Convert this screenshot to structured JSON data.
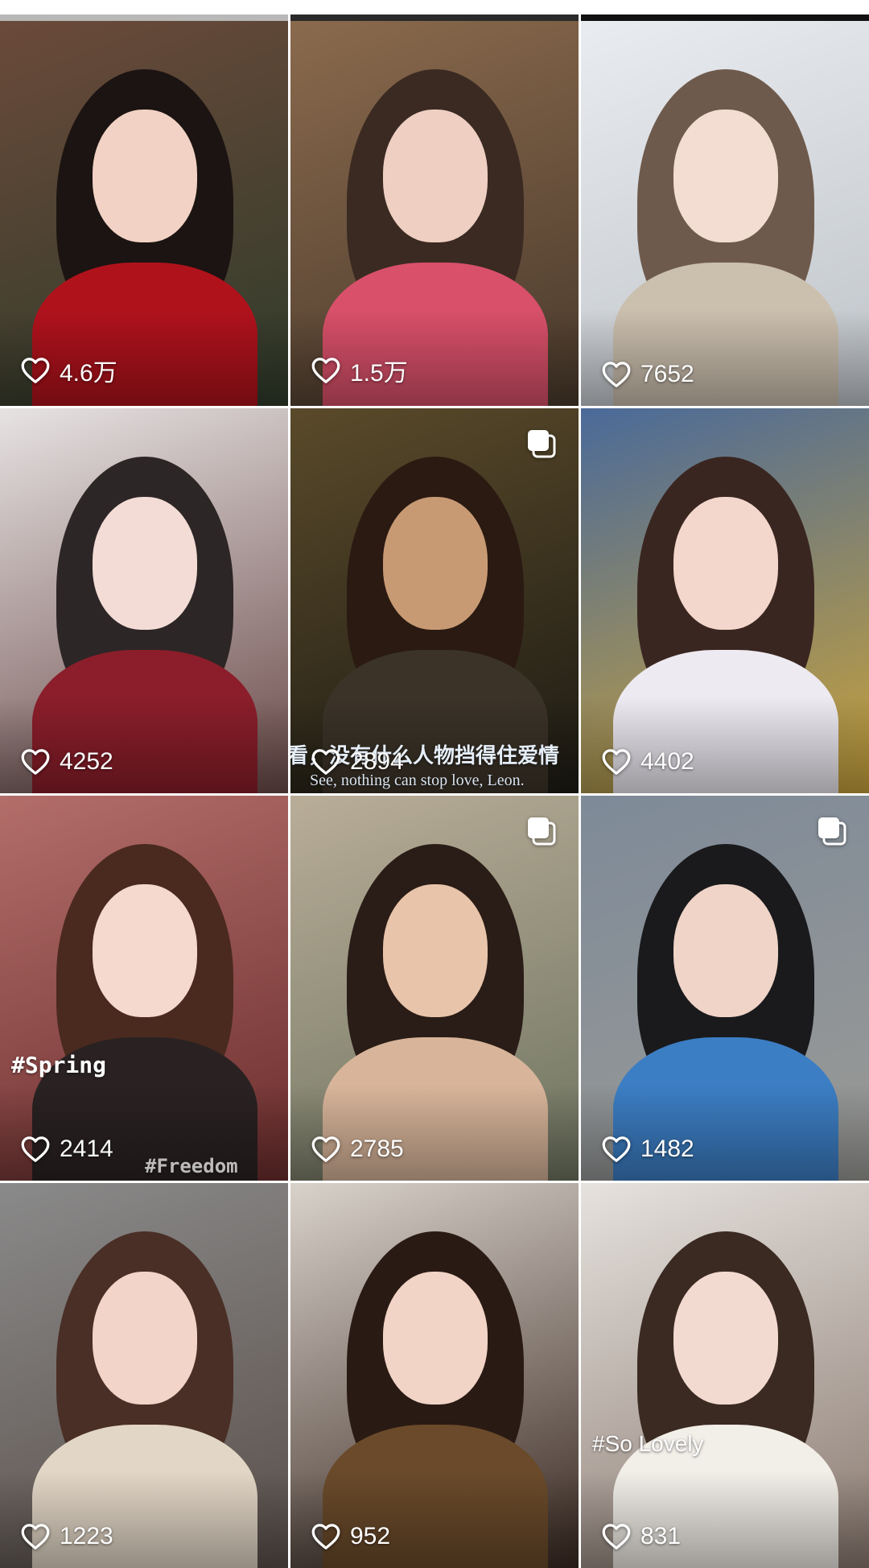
{
  "feed": {
    "tiles": [
      {
        "likes": "4.6万",
        "multi": false,
        "overlay": null,
        "bg": [
          "#6b4a3a",
          "#2f3b2a"
        ],
        "hair": "#1b1412",
        "face": "#f1d2c4",
        "body": "#b0121c"
      },
      {
        "likes": "1.5万",
        "multi": false,
        "overlay": null,
        "bg": [
          "#8a6a4d",
          "#4a3a2c"
        ],
        "hair": "#3a2a22",
        "face": "#efcfc2",
        "body": "#d9506a"
      },
      {
        "likes": "7652",
        "multi": false,
        "overlay": null,
        "bg": [
          "#e9ecf0",
          "#bfc4c9"
        ],
        "hair": "#6e5a4c",
        "face": "#f3dcd2",
        "body": "#cbbfae"
      },
      {
        "likes": "4252",
        "multi": false,
        "overlay": null,
        "bg": [
          "#e7e3e3",
          "#6a4a48"
        ],
        "hair": "#2d2626",
        "face": "#f4dcd6",
        "body": "#8b1e2a"
      },
      {
        "likes": "2894",
        "multi": true,
        "overlay": {
          "lines": [
            "看，没有什么人物挡得住爱情",
            "See, nothing can stop love, Leon."
          ]
        },
        "bg": [
          "#5a4a2a",
          "#1d1b14"
        ],
        "hair": "#2a1a12",
        "face": "#c89a74",
        "body": "#3b3328"
      },
      {
        "likes": "4402",
        "multi": false,
        "overlay": null,
        "bg": [
          "#4a6a9a",
          "#c9a23a"
        ],
        "hair": "#3a2620",
        "face": "#f3d6cc",
        "body": "#eeeaf2"
      },
      {
        "likes": "2414",
        "multi": false,
        "overlay": {
          "lines": [
            "#Spring",
            "#Freedom"
          ]
        },
        "bg": [
          "#b36e6a",
          "#6b2d2d"
        ],
        "hair": "#4a2a1e",
        "face": "#f5d8ce",
        "body": "#2a2222"
      },
      {
        "likes": "2785",
        "multi": true,
        "overlay": null,
        "bg": [
          "#b9ad98",
          "#6e7460"
        ],
        "hair": "#2a1c16",
        "face": "#e8c4aa",
        "body": "#d8b59a"
      },
      {
        "likes": "1482",
        "multi": true,
        "overlay": null,
        "bg": [
          "#7e8a98",
          "#9a9a96"
        ],
        "hair": "#1a1a1c",
        "face": "#f0d4c8",
        "body": "#3c7ec4"
      },
      {
        "likes": "1223",
        "multi": false,
        "overlay": null,
        "bg": [
          "#8a8a8a",
          "#5a4f4a"
        ],
        "hair": "#4a2f26",
        "face": "#f2d4c8",
        "body": "#e2d6c6"
      },
      {
        "likes": "952",
        "multi": false,
        "overlay": null,
        "bg": [
          "#d9d2cb",
          "#3a2a22"
        ],
        "hair": "#2a1a14",
        "face": "#f1d4c6",
        "body": "#6a4a2a"
      },
      {
        "likes": "831",
        "multi": false,
        "overlay": {
          "lines": [
            "#So Lovely"
          ]
        },
        "bg": [
          "#e6e2de",
          "#8a7a70"
        ],
        "hair": "#3a2a22",
        "face": "#f3dad0",
        "body": "#f2eee8"
      }
    ]
  }
}
